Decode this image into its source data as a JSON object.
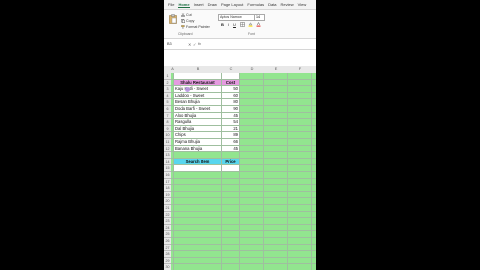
{
  "ribbon": {
    "tabs": [
      "File",
      "Home",
      "Insert",
      "Draw",
      "Page Layout",
      "Formulas",
      "Data",
      "Review",
      "View"
    ],
    "active_tab": "Home",
    "clipboard": {
      "cut": "Cut",
      "copy": "Copy",
      "format_painter": "Format Painter",
      "group_label": "Clipboard"
    },
    "font": {
      "name": "Aptos Narrow",
      "size": "14",
      "group_label": "Font"
    }
  },
  "formula_bar": {
    "name_box": "B3",
    "fx": "fx"
  },
  "grid": {
    "columns": [
      "A",
      "B",
      "C",
      "D",
      "E",
      "F",
      "G"
    ],
    "rows": [
      "1",
      "2",
      "3",
      "4",
      "5",
      "6",
      "7",
      "8",
      "9",
      "10",
      "11",
      "12",
      "13",
      "14",
      "15",
      "16",
      "17",
      "18",
      "19",
      "20",
      "21",
      "22",
      "23",
      "24",
      "25",
      "26",
      "27",
      "28",
      "29",
      "30"
    ],
    "table": {
      "header": {
        "item": "Shalu Restaurant",
        "cost": "Cost"
      },
      "items": [
        {
          "name": "Kaju Katli - Sweet",
          "cost": "50"
        },
        {
          "name": "Laddoo - Sweet",
          "cost": "60"
        },
        {
          "name": "Besan Bhujia",
          "cost": "80"
        },
        {
          "name": "Doda Barfi - Sweet",
          "cost": "90"
        },
        {
          "name": "Aloo Bhujia",
          "cost": "45"
        },
        {
          "name": "Rasgulla",
          "cost": "54"
        },
        {
          "name": "Dal Bhujia",
          "cost": "21"
        },
        {
          "name": "Chips",
          "cost": "89"
        },
        {
          "name": "Rajma Bhujia",
          "cost": "66"
        },
        {
          "name": "Banana Bhujia",
          "cost": "45"
        }
      ]
    },
    "search": {
      "item_label": "Search Item",
      "price_label": "Price"
    }
  }
}
